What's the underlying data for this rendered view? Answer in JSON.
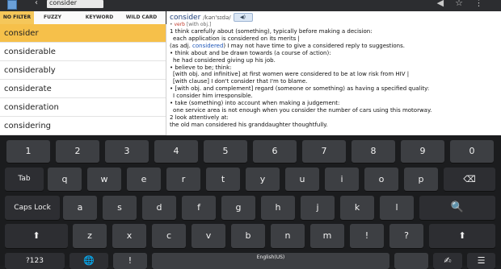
{
  "topbar": {
    "back_icon": "back-arrow-icon",
    "search_value": "consider",
    "icons": [
      "share-icon",
      "star-icon",
      "overflow-menu-icon"
    ]
  },
  "tabs": [
    {
      "label": "NO FILTER",
      "active": true
    },
    {
      "label": "FUZZY",
      "active": false
    },
    {
      "label": "KEYWORD",
      "active": false
    },
    {
      "label": "WILD CARD",
      "active": false
    }
  ],
  "words": [
    {
      "label": "consider",
      "selected": true
    },
    {
      "label": "considerable",
      "selected": false
    },
    {
      "label": "considerably",
      "selected": false
    },
    {
      "label": "considerate",
      "selected": false
    },
    {
      "label": "consideration",
      "selected": false
    },
    {
      "label": "considering",
      "selected": false
    }
  ],
  "definition": {
    "headword": "consider",
    "pronunciation": "/kən'sɪdə/",
    "speaker_label": "◀)",
    "pos": "verb",
    "pos_note": "[with obj.]",
    "lines": [
      "1 think carefully about (something), typically before making a decision:",
      "each application is considered on its merits |",
      "(as adj. considered) I may not have time to give a considered reply to suggestions.",
      "• think about and be drawn towards (a course of action):",
      "he had considered giving up his job.",
      "• believe to be; think:",
      "[with obj. and infinitive] at first women were considered to be at low risk from HIV |",
      "[with clause] I don't consider that I'm to blame.",
      "• [with obj. and complement] regard (someone or something) as having a specified quality:",
      "I consider him irresponsible.",
      "• take (something) into account when making a judgement:",
      "one service area is not enough when you consider the number of cars using this motorway.",
      "2 look attentively at:",
      "the old man considered his granddaughter thoughtfully."
    ]
  },
  "keyboard": {
    "row1": [
      "1",
      "2",
      "3",
      "4",
      "5",
      "6",
      "7",
      "8",
      "9",
      "0"
    ],
    "row2": [
      "Tab",
      "q",
      "w",
      "e",
      "r",
      "t",
      "y",
      "u",
      "i",
      "o",
      "p",
      "⌫"
    ],
    "row3": [
      "Caps Lock",
      "a",
      "s",
      "d",
      "f",
      "g",
      "h",
      "j",
      "k",
      "l",
      "🔍"
    ],
    "row4": [
      "⬆",
      "z",
      "x",
      "c",
      "v",
      "b",
      "n",
      "m",
      "!",
      "?",
      "⬆"
    ],
    "row5": [
      "?123",
      "🌐",
      "!",
      "English(US)",
      "",
      "✍",
      "☰"
    ]
  }
}
